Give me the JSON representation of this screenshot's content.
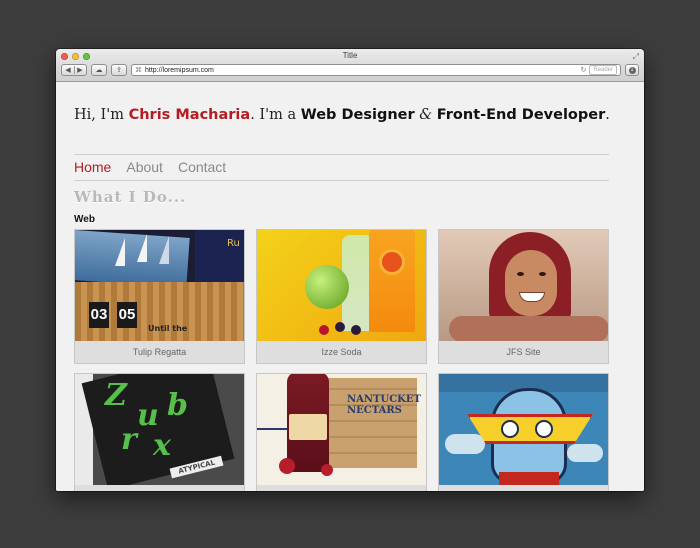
{
  "window": {
    "title": "Title"
  },
  "toolbar": {
    "url": "http://loremipsum.com",
    "reader_label": "Reader",
    "icons": [
      "back-icon",
      "forward-icon",
      "icloud-icon",
      "share-icon",
      "reload-icon",
      "downloads-icon",
      "fullscreen-icon"
    ]
  },
  "intro": {
    "greeting": "Hi,",
    "im": " I'm ",
    "name": "Chris Macharia",
    "mid": ". I'm a ",
    "role1": "Web Designer",
    "amp": " & ",
    "role2": "Front-End Developer",
    "end": "."
  },
  "nav": {
    "items": [
      {
        "label": "Home",
        "active": true
      },
      {
        "label": "About",
        "active": false
      },
      {
        "label": "Contact",
        "active": false
      }
    ]
  },
  "section": {
    "title": "What I Do..."
  },
  "category": {
    "label": "Web"
  },
  "thumbs": {
    "tulip": {
      "ru": "Ru",
      "d1": "03",
      "d2": "05",
      "until": "Until the"
    },
    "atypical": {
      "label": "ATYPICAL"
    },
    "nantucket": {
      "crate_label": "NANTUCKET NECTARS"
    }
  },
  "projects": [
    {
      "title": "Tulip Regatta"
    },
    {
      "title": "Izze Soda"
    },
    {
      "title": "JFS Site"
    },
    {
      "title": ""
    },
    {
      "title": ""
    },
    {
      "title": ""
    }
  ],
  "colors": {
    "accent": "#b31d23",
    "nav_inactive": "#8a8a8a",
    "background": "#3d3d3d"
  }
}
